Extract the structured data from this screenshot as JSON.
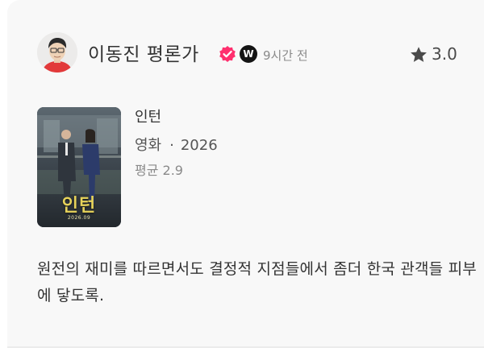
{
  "review": {
    "reviewer_name": "이동진 평론가",
    "badge_letter": "W",
    "time_ago": "9시간 전",
    "rating": "3.0",
    "text": "원전의 재미를 따르면서도 결정적 지점들에서 좀더 한국 관객들 피부에 닿도록."
  },
  "movie": {
    "title": "인턴",
    "type": "영화",
    "separator": "·",
    "year": "2026",
    "average": "평균 2.9",
    "poster": {
      "title": "인턴",
      "date": "2026.09"
    }
  },
  "icons": {
    "avatar": "avatar",
    "verified": "check-badge-icon",
    "watcha": "watcha-logo-icon",
    "star": "star-icon"
  },
  "colors": {
    "verified_accent": "#ff2f6e",
    "poster_title": "#e7d35a",
    "text_primary": "#333333",
    "text_muted": "#8a8a8a"
  }
}
